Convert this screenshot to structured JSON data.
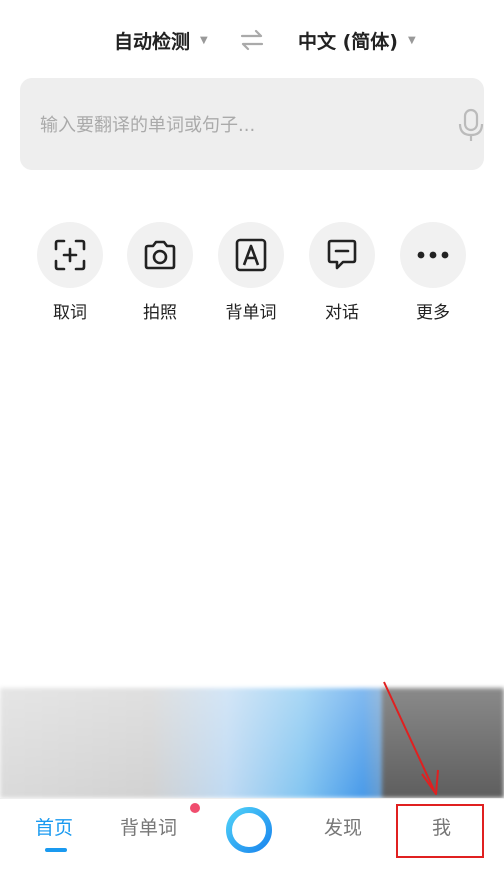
{
  "lang_bar": {
    "source": "自动检测",
    "target": "中文 (简体)",
    "swap_icon": "swap-arrows-icon",
    "caret_icon": "caret-down-icon"
  },
  "search": {
    "placeholder": "输入要翻译的单词或句子...",
    "value": "",
    "mic_icon": "microphone-icon"
  },
  "tools": [
    {
      "label": "取词",
      "icon": "scan-add-icon"
    },
    {
      "label": "拍照",
      "icon": "camera-icon"
    },
    {
      "label": "背单词",
      "icon": "letter-a-card-icon"
    },
    {
      "label": "对话",
      "icon": "chat-bubble-icon"
    },
    {
      "label": "更多",
      "icon": "more-dots-icon"
    }
  ],
  "tabbar": {
    "items": [
      {
        "label": "首页",
        "active": true
      },
      {
        "label": "背单词",
        "badge": "dot"
      },
      {
        "label": "",
        "icon": "assistant-ring-icon"
      },
      {
        "label": "发现"
      },
      {
        "label": "我"
      }
    ]
  },
  "colors": {
    "accent": "#1a9af0",
    "badge": "#f04d6e",
    "annotation": "#e02020"
  },
  "annotation": {
    "type": "red-box-with-arrow",
    "target": "tab-me"
  }
}
